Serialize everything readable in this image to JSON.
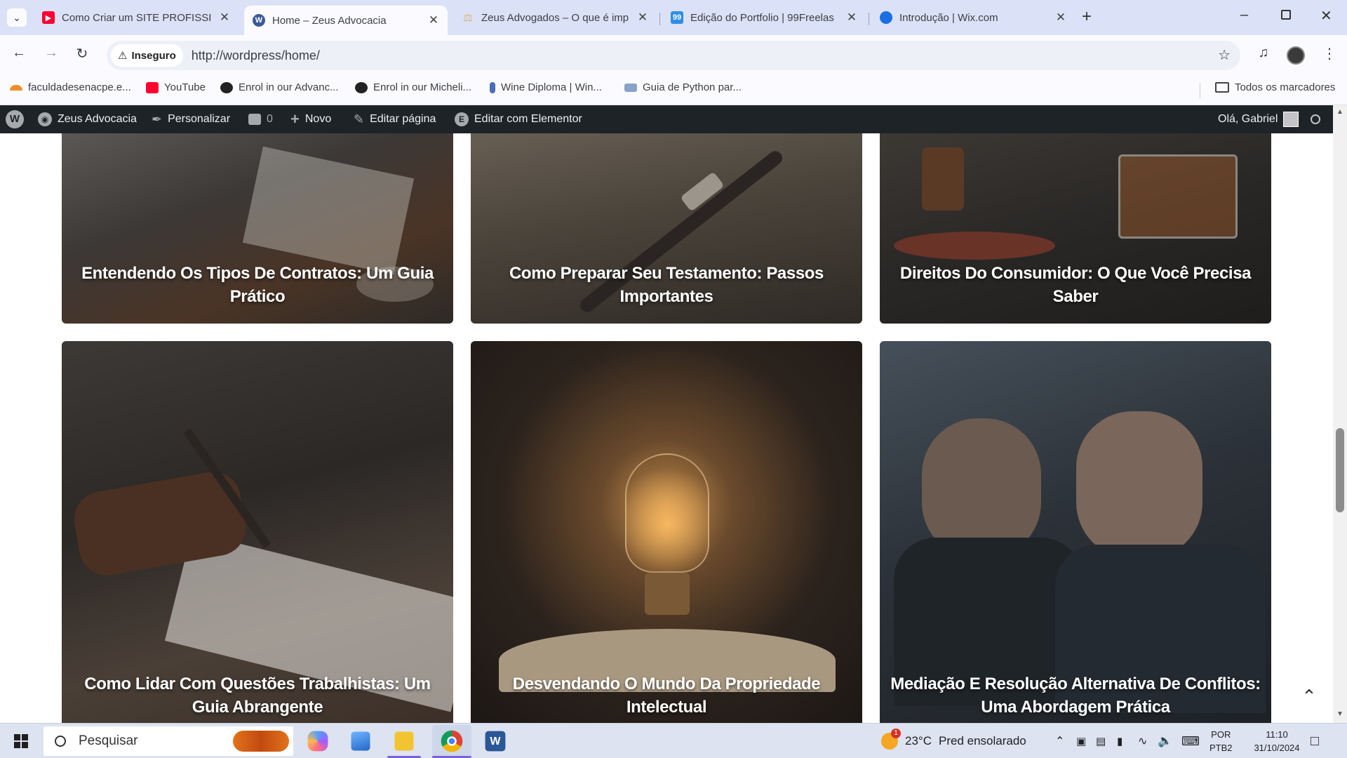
{
  "browser": {
    "tabs": [
      {
        "title": "Como Criar um SITE PROFISSIO",
        "favicon": "youtube-icon",
        "favcolor": "#ff0033",
        "active": false
      },
      {
        "title": "Home – Zeus Advocacia",
        "favicon": "wordpress-icon",
        "favcolor": "#3c5a99",
        "active": true
      },
      {
        "title": "Zeus Advogados – O que é imp",
        "favicon": "scales-icon",
        "favcolor": "#d8b26a",
        "active": false
      },
      {
        "title": "Edição do Portfolio | 99Freelas",
        "favicon": "99freelas-icon",
        "favcolor": "#2f8ee6",
        "active": false
      },
      {
        "title": "Introdução | Wix.com",
        "favicon": "wix-icon",
        "favcolor": "#1b6fe3",
        "active": false
      }
    ],
    "security_label": "Inseguro",
    "url": "http://wordpress/home/",
    "bookmarks": [
      {
        "label": "faculdadesenacpe.e...",
        "color": "#f08c2a"
      },
      {
        "label": "YouTube",
        "color": "#ff0033"
      },
      {
        "label": "Enrol in our Advanc...",
        "color": "#222222"
      },
      {
        "label": "Enrol in our Micheli...",
        "color": "#222222"
      },
      {
        "label": "Wine Diploma | Win...",
        "color": "#4a6fb5"
      },
      {
        "label": "Guia de Python par...",
        "color": "#8aa2c8"
      }
    ],
    "all_bookmarks": "Todos os marcadores"
  },
  "wpbar": {
    "site": "Zeus Advocacia",
    "customize": "Personalizar",
    "comments": "0",
    "new": "Novo",
    "edit_page": "Editar página",
    "elementor": "Editar com Elementor",
    "greeting": "Olá, Gabriel"
  },
  "posts": [
    {
      "title": "Entendendo Os Tipos De Contratos: Um Guia Prático"
    },
    {
      "title": "Como Preparar Seu Testamento: Passos Importantes"
    },
    {
      "title": "Direitos Do Consumidor: O Que Você Precisa Saber"
    },
    {
      "title": "Como Lidar Com Questões Trabalhistas: Um Guia Abrangente"
    },
    {
      "title": "Desvendando O Mundo Da Propriedade Intelectual"
    },
    {
      "title": "Mediação E Resolução Alternativa De Conflitos: Uma Abordagem Prática"
    }
  ],
  "taskbar": {
    "search_placeholder": "Pesquisar",
    "weather_temp": "23°C",
    "weather_desc": "Pred ensolarado",
    "lang_top": "POR",
    "lang_bottom": "PTB2",
    "time": "11:10",
    "date": "31/10/2024",
    "weather_badge": "1"
  }
}
